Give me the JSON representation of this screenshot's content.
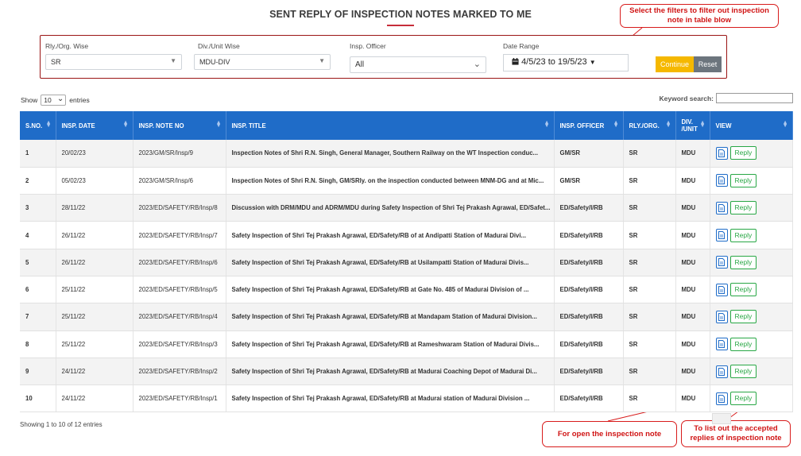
{
  "page": {
    "title": "SENT REPLY OF INSPECTION NOTES MARKED TO ME"
  },
  "annotations": {
    "filters_line1": "Select the filters to filter out inspection",
    "filters_line2": "note in table blow",
    "open_note": "For open the inspection note",
    "replies_line1": "To list out the accepted",
    "replies_line2": "replies of inspection note"
  },
  "filters": {
    "rly_label": "Rly./Org. Wise",
    "rly_value": "SR",
    "div_label": "Div./Unit Wise",
    "div_value": "MDU-DIV",
    "officer_label": "Insp. Officer",
    "officer_value": "All",
    "date_label": "Date Range",
    "date_value": "4/5/23 to 19/5/23",
    "continue_label": "Continue",
    "reset_label": "Reset"
  },
  "table_controls": {
    "show_label": "Show",
    "length_value": "10",
    "entries_label": "entries",
    "search_label": "Keyword search:",
    "search_value": ""
  },
  "columns": [
    "S.NO.",
    "INSP. DATE",
    "INSP. NOTE NO",
    "INSP. TITLE",
    "INSP. OFFICER",
    "RLY./ORG.",
    "DIV. /UNIT",
    "VIEW"
  ],
  "rows": [
    {
      "sno": "1",
      "date": "20/02/23",
      "note_no": "2023/GM/SR/Insp/9",
      "title": "Inspection Notes of Shri R.N. Singh, General Manager, Southern Railway on the WT Inspection conduc...",
      "officer": "GM/SR",
      "rly": "SR",
      "div": "MDU",
      "reply": "Reply"
    },
    {
      "sno": "2",
      "date": "05/02/23",
      "note_no": "2023/GM/SR/Insp/6",
      "title": "Inspection Notes of Shri R.N. Singh, GM/SRly. on the inspection conducted between MNM-DG and at Mic...",
      "officer": "GM/SR",
      "rly": "SR",
      "div": "MDU",
      "reply": "Reply"
    },
    {
      "sno": "3",
      "date": "28/11/22",
      "note_no": "2023/ED/SAFETY/RB/Insp/8",
      "title": "Discussion with DRM/MDU and ADRM/MDU during Safety Inspection of Shri Tej Prakash Agrawal, ED/Safet...",
      "officer": "ED/Safety/I/RB",
      "rly": "SR",
      "div": "MDU",
      "reply": "Reply"
    },
    {
      "sno": "4",
      "date": "26/11/22",
      "note_no": "2023/ED/SAFETY/RB/Insp/7",
      "title": "Safety Inspection of Shri Tej Prakash Agrawal, ED/Safety/RB of at Andipatti Station of Madurai Divi...",
      "officer": "ED/Safety/I/RB",
      "rly": "SR",
      "div": "MDU",
      "reply": "Reply"
    },
    {
      "sno": "5",
      "date": "26/11/22",
      "note_no": "2023/ED/SAFETY/RB/Insp/6",
      "title": "Safety Inspection of Shri Tej Prakash Agrawal, ED/Safety/RB at Usilampatti Station of Madurai Divis...",
      "officer": "ED/Safety/I/RB",
      "rly": "SR",
      "div": "MDU",
      "reply": "Reply"
    },
    {
      "sno": "6",
      "date": "25/11/22",
      "note_no": "2023/ED/SAFETY/RB/Insp/5",
      "title": "Safety Inspection of Shri Tej Prakash Agrawal, ED/Safety/RB at Gate No. 485 of Madurai Division of ...",
      "officer": "ED/Safety/I/RB",
      "rly": "SR",
      "div": "MDU",
      "reply": "Reply"
    },
    {
      "sno": "7",
      "date": "25/11/22",
      "note_no": "2023/ED/SAFETY/RB/Insp/4",
      "title": "Safety Inspection of Shri Tej Prakash Agrawal, ED/Safety/RB at Mandapam Station of Madurai Division...",
      "officer": "ED/Safety/I/RB",
      "rly": "SR",
      "div": "MDU",
      "reply": "Reply"
    },
    {
      "sno": "8",
      "date": "25/11/22",
      "note_no": "2023/ED/SAFETY/RB/Insp/3",
      "title": "Safety Inspection of Shri Tej Prakash Agrawal, ED/Safety/RB at Rameshwaram Station of Madurai Divis...",
      "officer": "ED/Safety/I/RB",
      "rly": "SR",
      "div": "MDU",
      "reply": "Reply"
    },
    {
      "sno": "9",
      "date": "24/11/22",
      "note_no": "2023/ED/SAFETY/RB/Insp/2",
      "title": "Safety Inspection of Shri Tej Prakash Agrawal, ED/Safety/RB at Madurai Coaching Depot of Madurai Di...",
      "officer": "ED/Safety/I/RB",
      "rly": "SR",
      "div": "MDU",
      "reply": "Reply"
    },
    {
      "sno": "10",
      "date": "24/11/22",
      "note_no": "2023/ED/SAFETY/RB/Insp/1",
      "title": "Safety Inspection of Shri Tej Prakash Agrawal, ED/Safety/RB at Madurai station of Madurai Division ...",
      "officer": "ED/Safety/I/RB",
      "rly": "SR",
      "div": "MDU",
      "reply": "Reply"
    }
  ],
  "footer": {
    "showing": "Showing 1 to 10 of 12 entries"
  },
  "icons": {
    "calendar": "calendar-icon",
    "document": "document-icon",
    "sort": "sort-arrows-icon"
  },
  "colors": {
    "header_blue": "#1f6cc8",
    "accent_red": "#c62d3a",
    "continue_yellow": "#f5b800",
    "reply_green": "#28a745",
    "annotation_red": "#d01414"
  }
}
